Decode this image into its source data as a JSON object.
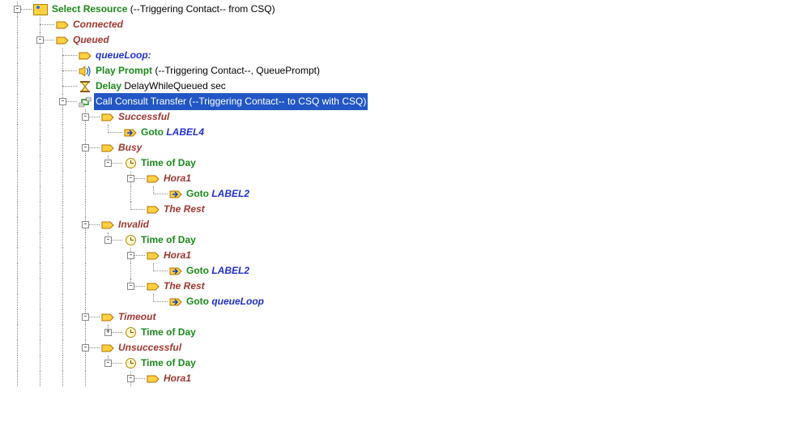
{
  "root": {
    "label_a": "Select Resource ",
    "label_b": "(--Triggering Contact-- from CSQ)"
  },
  "connected": "Connected",
  "queued": "Queued",
  "queueLoop": "queueLoop:",
  "playPrompt": {
    "a": "Play Prompt ",
    "b": "(--Triggering Contact--, QueuePrompt)"
  },
  "delay": {
    "a": "Delay",
    "b": " DelayWhileQueued sec"
  },
  "callConsult": "Call Consult Transfer (--Triggering Contact-- to CSQ with CSQ)",
  "successful": "Successful",
  "goto": "Goto ",
  "label4": "LABEL4",
  "busy": "Busy",
  "timeOfDay": "Time of Day",
  "hora1": "Hora1",
  "label2": "LABEL2",
  "theRest": "The Rest",
  "invalid": "Invalid",
  "queueLoopRef": "queueLoop",
  "timeout": "Timeout",
  "unsuccessful": "Unsuccessful"
}
